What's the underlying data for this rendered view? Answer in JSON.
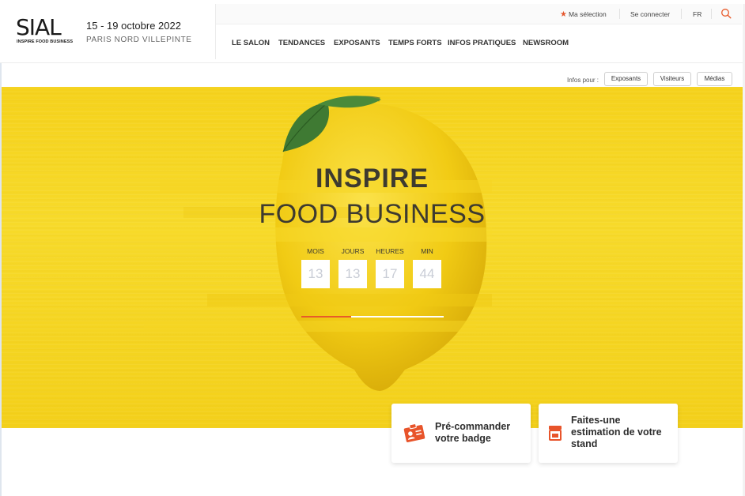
{
  "brand": {
    "logo_text": "SIAL",
    "tagline": "INSPIRE FOOD BUSINESS",
    "dates": "15 - 19 octobre 2022",
    "venue": "PARIS NORD VILLEPINTE",
    "accent_color": "#e85a2a"
  },
  "utility": {
    "selection_label": "Ma sélection",
    "selection_icon": "star-icon",
    "login_label": "Se connecter",
    "language": "FR",
    "search_icon": "search-icon"
  },
  "nav": {
    "items": [
      {
        "label": "LE SALON"
      },
      {
        "label": "TENDANCES"
      },
      {
        "label": "EXPOSANTS"
      },
      {
        "label": "TEMPS FORTS"
      },
      {
        "label": "INFOS PRATIQUES"
      },
      {
        "label": "NEWSROOM"
      }
    ]
  },
  "infos": {
    "label": "Infos pour :",
    "buttons": [
      {
        "label": "Exposants"
      },
      {
        "label": "Visiteurs"
      },
      {
        "label": "Médias"
      }
    ]
  },
  "hero": {
    "title_line1": "INSPIRE",
    "title_line2": "FOOD BUSINESS",
    "countdown": [
      {
        "label": "MOIS",
        "value": "13"
      },
      {
        "label": "JOURS",
        "value": "13"
      },
      {
        "label": "HEURES",
        "value": "17"
      },
      {
        "label": "MIN",
        "value": "44"
      }
    ],
    "slide_progress": 0.35
  },
  "cards": [
    {
      "label": "Pré-commander votre badge",
      "icon": "badge-icon"
    },
    {
      "label": "Faites-une estimation de votre stand",
      "icon": "stand-icon"
    }
  ]
}
